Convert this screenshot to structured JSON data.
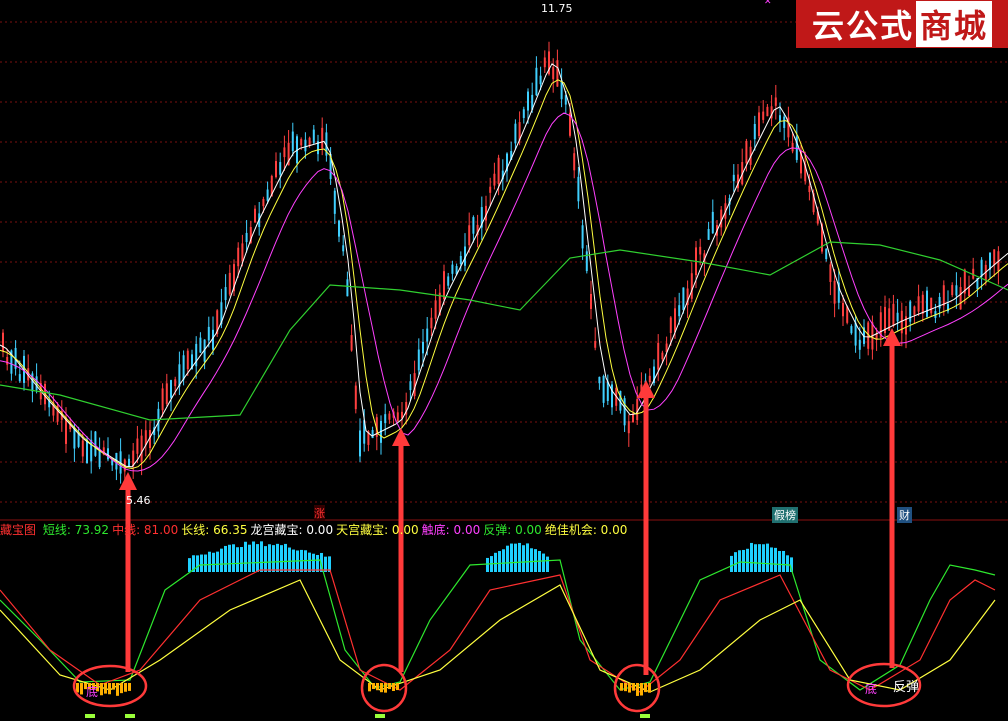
{
  "brand": {
    "part1": "云公式",
    "part2": "商城"
  },
  "main_chart": {
    "price_high_label": "11.75",
    "price_low_label": "5.46",
    "top_marker": "✕",
    "tags": {
      "zhang": "涨",
      "maobang": "假榜",
      "cai": "财"
    }
  },
  "indicator": {
    "name": "藏宝图",
    "items": [
      {
        "label": "短线:",
        "value": "73.92",
        "color": "#2ee82e"
      },
      {
        "label": "中线:",
        "value": "81.00",
        "color": "#ff3030"
      },
      {
        "label": "长线:",
        "value": "66.35",
        "color": "#ffff40"
      },
      {
        "label": "龙宫藏宝:",
        "value": "0.00",
        "color": "#ffffff"
      },
      {
        "label": "天宫藏宝:",
        "value": "0.00",
        "color": "#ffff40"
      },
      {
        "label": "触底:",
        "value": "0.00",
        "color": "#ff40ff"
      },
      {
        "label": "反弹:",
        "value": "0.00",
        "color": "#2ee82e"
      },
      {
        "label": "绝佳机会:",
        "value": "0.00",
        "color": "#ffff40"
      }
    ],
    "circle_labels": {
      "di": "底",
      "fantan": "反弹"
    }
  },
  "colors": {
    "up_candle": "#ff4040",
    "down_candle": "#40d0ff",
    "ma_white": "#ffffff",
    "ma_yellow": "#ffff40",
    "ma_magenta": "#ff40ff",
    "ma_green": "#30d030",
    "histogram": "#1fd0ff",
    "arrow": "#ff3a3a",
    "grid": "#7a1010"
  }
}
